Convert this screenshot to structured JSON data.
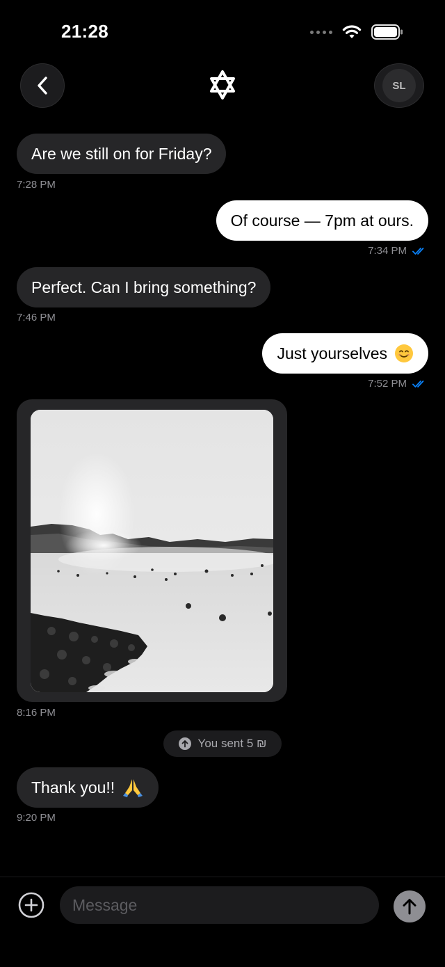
{
  "status_bar": {
    "time": "21:28",
    "icons": [
      "signal-dots-icon",
      "wifi-icon",
      "battery-icon"
    ]
  },
  "header": {
    "back_icon": "chevron-left-icon",
    "center_icon": "star-of-david-icon",
    "avatar_initials": "SL"
  },
  "messages": [
    {
      "direction": "incoming",
      "text": "Are we still on for Friday?",
      "time": "7:28 PM"
    },
    {
      "direction": "outgoing",
      "text": "Of course — 7pm at ours.",
      "time": "7:34 PM",
      "status_icon": "double-check-icon"
    },
    {
      "direction": "incoming",
      "text": "Perfect. Can I bring something?",
      "time": "7:46 PM"
    },
    {
      "direction": "outgoing",
      "text": "Just yourselves",
      "emoji": "smiling-face-emoji",
      "time": "7:52 PM",
      "status_icon": "double-check-icon"
    },
    {
      "direction": "incoming",
      "type": "photo",
      "time": "8:16 PM"
    },
    {
      "direction": "incoming",
      "text": "Thank you!!",
      "emoji": "folded-hands-emoji",
      "time": "9:20 PM"
    }
  ],
  "payment_notice": {
    "icon": "arrow-up-circle-icon",
    "text": "You sent 5 ₪"
  },
  "composer": {
    "add_icon": "plus-circle-icon",
    "placeholder": "Message",
    "value": "",
    "send_icon": "arrow-up-icon"
  },
  "colors": {
    "background": "#000000",
    "incoming_bubble": "#262628",
    "outgoing_bubble": "#ffffff",
    "read_check": "#0a84ff",
    "timestamp": "#8e8e93"
  }
}
